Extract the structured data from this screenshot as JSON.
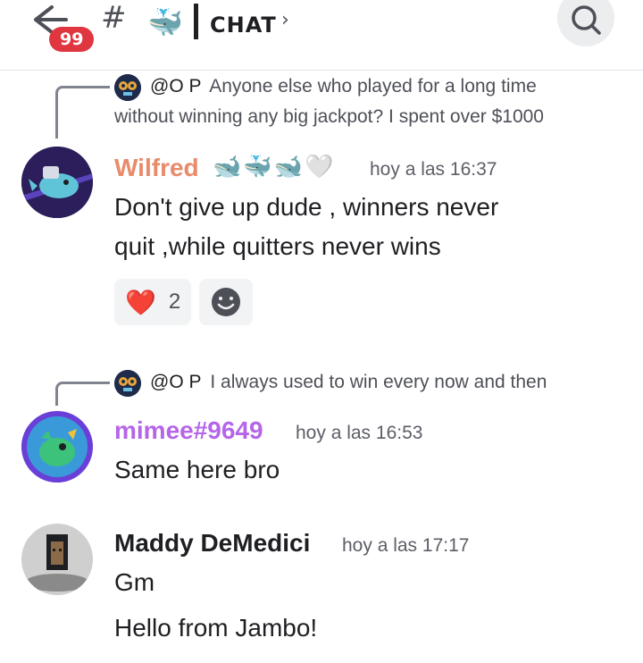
{
  "header": {
    "unread_count": "99",
    "hash": "#",
    "channel_emoji": "🐳",
    "channel_name": "CHAT",
    "chevron": "›"
  },
  "messages": [
    {
      "reply": {
        "author": "@O P",
        "text_line1": "Anyone else who played for a long time",
        "text_line2": "without winning any big jackpot? I spent over $1000"
      },
      "username": "Wilfred",
      "username_color": "#e88b6b",
      "badges": "🐋🐳🐋🤍",
      "timestamp": "hoy a las 16:37",
      "content_line1": "Don't give up dude , winners never",
      "content_line2": "quit ,while quitters never wins",
      "reactions": [
        {
          "emoji": "❤️",
          "count": "2"
        }
      ]
    },
    {
      "reply": {
        "author": "@O P",
        "text_line1": "I always used to win every now and then"
      },
      "username": "mimee#9649",
      "username_color": "#b565e8",
      "timestamp": "hoy a las 16:53",
      "content_line1": "Same here bro"
    },
    {
      "username": "Maddy DeMedici",
      "username_color": "#1e1f22",
      "timestamp": "hoy a las 17:17",
      "content_line1": "Gm",
      "content_line2": "Hello from Jambo!"
    }
  ]
}
